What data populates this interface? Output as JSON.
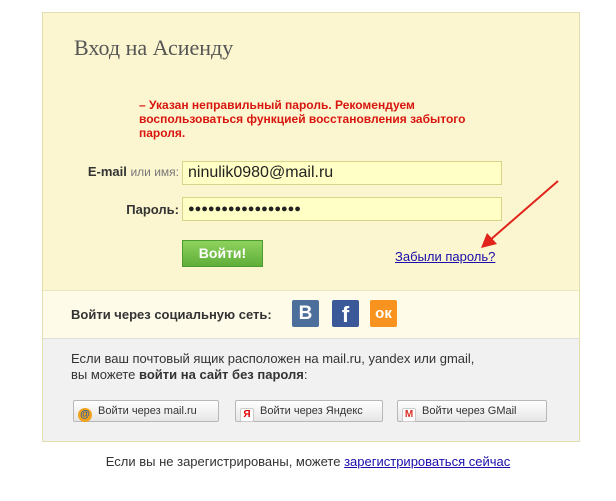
{
  "login": {
    "title": "Вход на Асиенду",
    "error": "– Указан неправильный пароль. Рекомендуем воспользоваться функцией восстановления забытого пароля.",
    "email_label_bold": "E-mail",
    "email_label_muted": "или имя:",
    "email_value": "ninulik0980@mail.ru",
    "password_label": "Пароль:",
    "password_value": "●●●●●●●●●●●●●●●●●",
    "submit_label": "Войти!",
    "forgot_label": "Забыли пароль?"
  },
  "social": {
    "label": "Войти через социальную сеть:",
    "vk_glyph": "B",
    "fb_glyph": "f",
    "ok_glyph": "ок"
  },
  "nopass": {
    "line1": "Если ваш почтовый ящик расположен на mail.ru, yandex или gmail,",
    "line2_prefix": "вы можете ",
    "line2_bold": "войти на сайт без пароля",
    "line2_suffix": ":",
    "buttons": [
      {
        "label": "Войти через mail.ru",
        "icon": "mailru-icon",
        "glyph": "@"
      },
      {
        "label": "Войти через Яндекс",
        "icon": "yandex-icon",
        "glyph": "Я"
      },
      {
        "label": "Войти через GMail",
        "icon": "gmail-icon",
        "glyph": "M"
      }
    ]
  },
  "footer": {
    "text": "Если вы не зарегистрированы, можете ",
    "link": "зарегистрироваться сейчас"
  },
  "colors": {
    "accent_green": "#6cbd45",
    "error_red": "#d9150f",
    "link_blue": "#1a0dab",
    "panel_yellow": "#fbf6cf"
  }
}
